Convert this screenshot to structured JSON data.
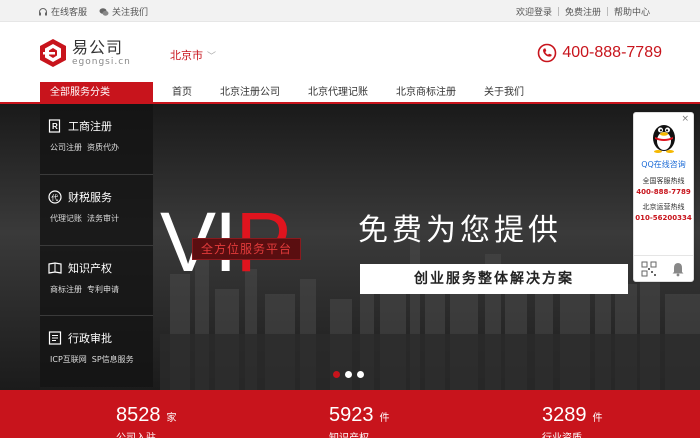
{
  "topbar": {
    "service": "在线客服",
    "follow": "关注我们",
    "login": "欢迎登录",
    "register": "免费注册",
    "help": "帮助中心"
  },
  "header": {
    "logo_cn": "易公司",
    "logo_en": "egongsi.cn",
    "city": "北京市",
    "hotline": "400-888-7789"
  },
  "nav": {
    "category_label": "全部服务分类",
    "links": [
      "首页",
      "北京注册公司",
      "北京代理记账",
      "北京商标注册",
      "关于我们"
    ]
  },
  "sidebar": {
    "items": [
      {
        "title": "工商注册",
        "subs": [
          "公司注册",
          "资质代办"
        ],
        "icon": "document-icon"
      },
      {
        "title": "财税服务",
        "subs": [
          "代理记账",
          "法务审计"
        ],
        "icon": "tax-icon"
      },
      {
        "title": "知识产权",
        "subs": [
          "商标注册",
          "专利申请"
        ],
        "icon": "book-icon"
      },
      {
        "title": "行政审批",
        "subs": [
          "ICP互联网",
          "SP信息服务"
        ],
        "icon": "approval-icon"
      }
    ]
  },
  "banner": {
    "vip_left": "VI",
    "vip_right": "P",
    "tag": "全方位服务平台",
    "headline": "免费为您提供",
    "subline": "创业服务整体解决方案",
    "active_slide": 1,
    "slide_count": 3
  },
  "qq": {
    "close": "×",
    "title": "QQ在线咨询",
    "line1_label": "全国客服热线",
    "line1_num": "400-888-7789",
    "line2_label": "北京运营热线",
    "line2_num": "010-56200334"
  },
  "stats": [
    {
      "num": "8528",
      "unit": "家",
      "label": "公司入驻"
    },
    {
      "num": "5923",
      "unit": "件",
      "label": "知识产权"
    },
    {
      "num": "3289",
      "unit": "件",
      "label": "行业资质"
    }
  ],
  "colors": {
    "brand": "#c8141c",
    "banner_bg": "#2c2c2c"
  }
}
